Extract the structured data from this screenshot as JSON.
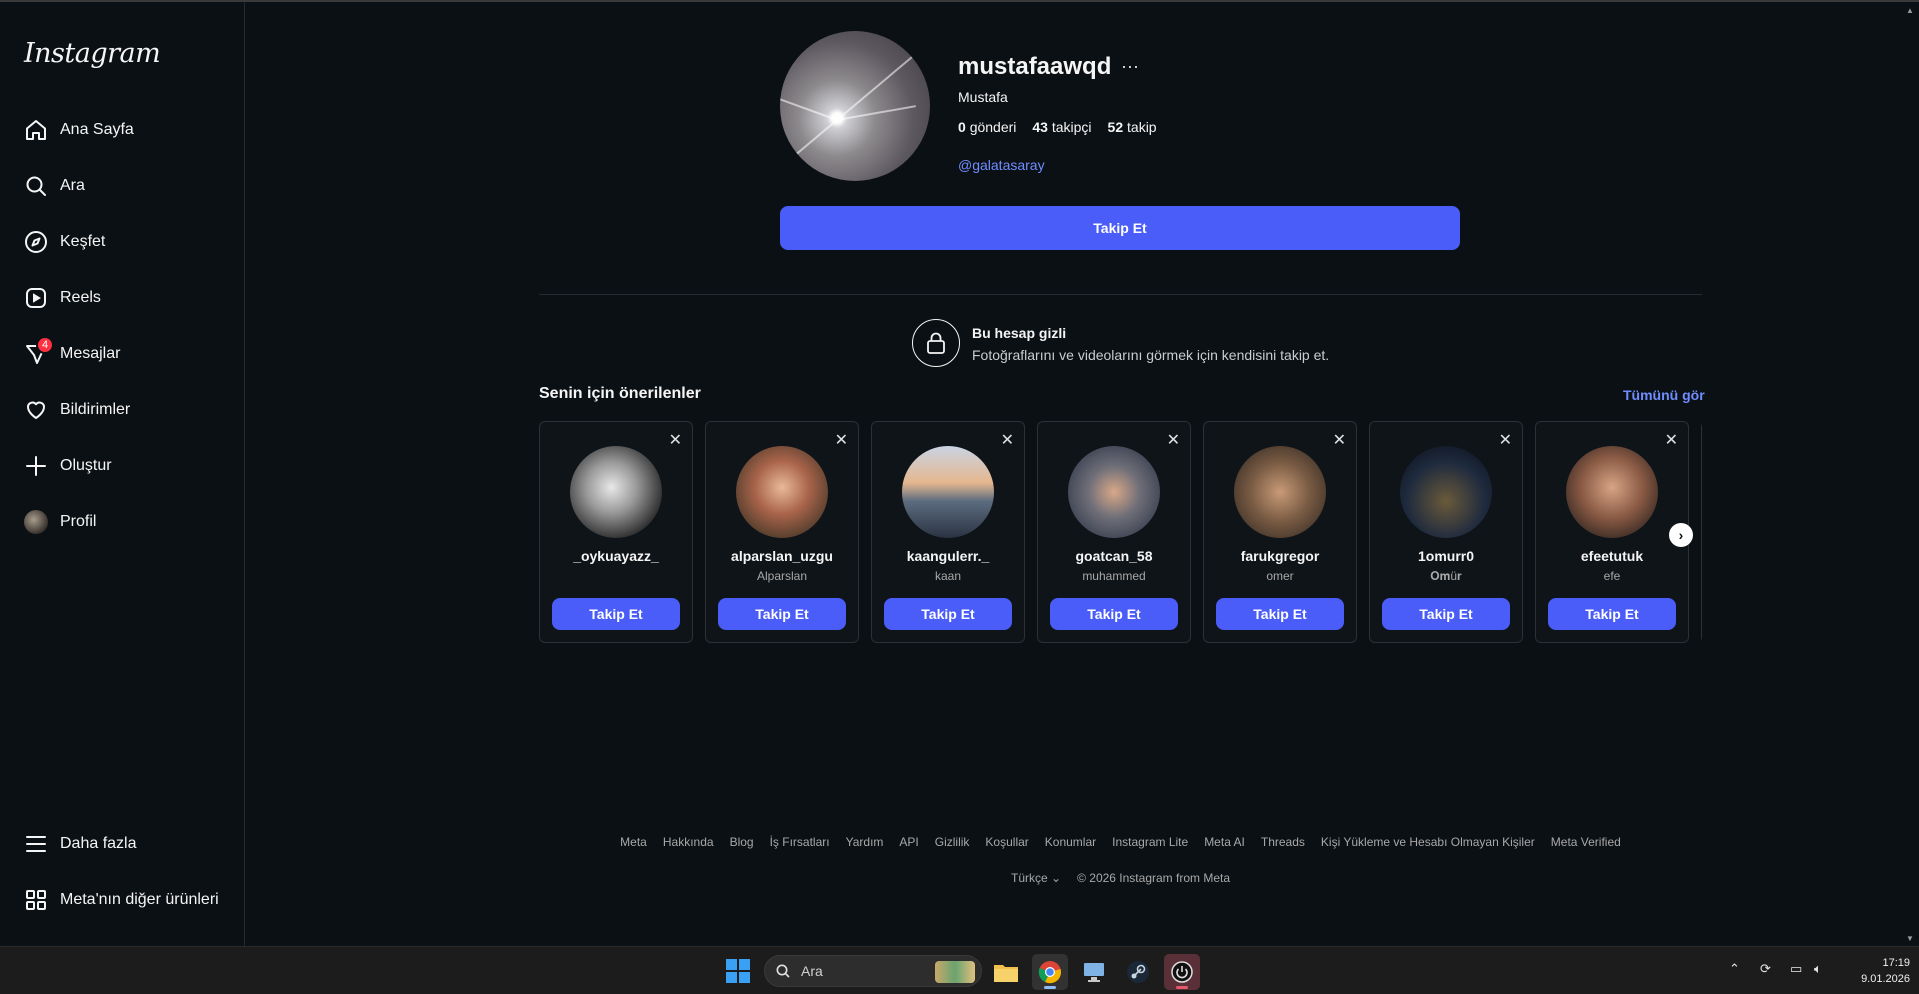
{
  "sidebar": {
    "logo": "Instagram",
    "items": [
      {
        "label": "Ana Sayfa",
        "icon": "home-icon"
      },
      {
        "label": "Ara",
        "icon": "search-icon"
      },
      {
        "label": "Keşfet",
        "icon": "compass-icon"
      },
      {
        "label": "Reels",
        "icon": "reels-icon"
      },
      {
        "label": "Mesajlar",
        "icon": "messenger-icon",
        "badge": "4"
      },
      {
        "label": "Bildirimler",
        "icon": "heart-icon"
      },
      {
        "label": "Oluştur",
        "icon": "plus-icon"
      },
      {
        "label": "Profil",
        "icon": "avatar"
      }
    ],
    "more": {
      "label": "Daha fazla",
      "icon": "menu-icon"
    },
    "meta_products": {
      "label": "Meta'nın diğer ürünleri",
      "icon": "apps-grid-icon"
    }
  },
  "profile": {
    "username": "mustafaawqd",
    "more_icon": "···",
    "full_name": "Mustafa",
    "posts_count": "0",
    "posts_label": "gönderi",
    "followers_count": "43",
    "followers_label": "takipçi",
    "following_count": "52",
    "following_label": "takip",
    "bio_link": "@galatasaray",
    "follow_button": "Takip Et"
  },
  "private_notice": {
    "title": "Bu hesap gizli",
    "subtitle": "Fotoğraflarını ve videolarını görmek için kendisini takip et."
  },
  "suggestions": {
    "title": "Senin için önerilenler",
    "see_all": "Tümünü gör",
    "close_icon": "✕",
    "cards": [
      {
        "username": "_oykuayazz_",
        "subtitle": "",
        "button": "Takip Et"
      },
      {
        "username": "alparslan_uzgu",
        "subtitle": "Alparslan",
        "button": "Takip Et"
      },
      {
        "username": "kaangulerr._",
        "subtitle": "kaan",
        "button": "Takip Et"
      },
      {
        "username": "goatcan_58",
        "subtitle": "muhammed",
        "button": "Takip Et"
      },
      {
        "username": "farukgregor",
        "subtitle": "omer",
        "button": "Takip Et"
      },
      {
        "username": "1omurr0",
        "subtitle": "𝐎𝐦ü𝐫",
        "button": "Takip Et"
      },
      {
        "username": "efeetutuk",
        "subtitle": "efe",
        "button": "Takip Et"
      }
    ]
  },
  "footer": {
    "links": [
      "Meta",
      "Hakkında",
      "Blog",
      "İş Fırsatları",
      "Yardım",
      "API",
      "Gizlilik",
      "Koşullar",
      "Konumlar",
      "Instagram Lite",
      "Meta AI",
      "Threads",
      "Kişi Yükleme ve Hesabı Olmayan Kişiler",
      "Meta Verified"
    ],
    "language": "Türkçe",
    "copyright": "© 2026 Instagram from Meta"
  },
  "taskbar": {
    "search_placeholder": "Ara",
    "time": "17:19",
    "date": "9.01.2026"
  },
  "colors": {
    "background": "#0b1014",
    "accent": "#4a5df9",
    "link": "#708dff",
    "badge": "#ff3040"
  }
}
